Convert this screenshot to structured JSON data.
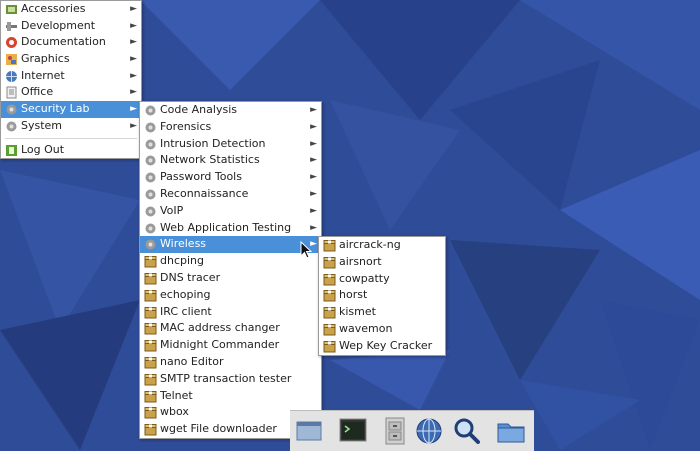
{
  "main_menu": {
    "items": [
      {
        "label": "Accessories",
        "icon": "accessories-icon",
        "submenu": true
      },
      {
        "label": "Development",
        "icon": "development-icon",
        "submenu": true
      },
      {
        "label": "Documentation",
        "icon": "documentation-icon",
        "submenu": true
      },
      {
        "label": "Graphics",
        "icon": "graphics-icon",
        "submenu": true
      },
      {
        "label": "Internet",
        "icon": "internet-icon",
        "submenu": true
      },
      {
        "label": "Office",
        "icon": "office-icon",
        "submenu": true
      },
      {
        "label": "Security Lab",
        "icon": "gear-icon",
        "submenu": true,
        "active": true
      },
      {
        "label": "System",
        "icon": "gear-icon",
        "submenu": true
      }
    ],
    "logout_label": "Log Out"
  },
  "security_menu": {
    "items": [
      {
        "label": "Code Analysis",
        "icon": "gear-icon",
        "submenu": true
      },
      {
        "label": "Forensics",
        "icon": "gear-icon",
        "submenu": true
      },
      {
        "label": "Intrusion Detection",
        "icon": "gear-icon",
        "submenu": true
      },
      {
        "label": "Network Statistics",
        "icon": "gear-icon",
        "submenu": true
      },
      {
        "label": "Password Tools",
        "icon": "gear-icon",
        "submenu": true
      },
      {
        "label": "Reconnaissance",
        "icon": "gear-icon",
        "submenu": true
      },
      {
        "label": "VoIP",
        "icon": "gear-icon",
        "submenu": true
      },
      {
        "label": "Web Application Testing",
        "icon": "gear-icon",
        "submenu": true
      },
      {
        "label": "Wireless",
        "icon": "gear-icon",
        "submenu": true,
        "active": true
      },
      {
        "label": "dhcping",
        "icon": "package-icon"
      },
      {
        "label": "DNS tracer",
        "icon": "package-icon"
      },
      {
        "label": "echoping",
        "icon": "package-icon"
      },
      {
        "label": "IRC client",
        "icon": "package-icon"
      },
      {
        "label": "MAC address changer",
        "icon": "package-icon"
      },
      {
        "label": "Midnight Commander",
        "icon": "package-icon"
      },
      {
        "label": "nano Editor",
        "icon": "package-icon"
      },
      {
        "label": "SMTP transaction tester",
        "icon": "package-icon"
      },
      {
        "label": "Telnet",
        "icon": "package-icon"
      },
      {
        "label": "wbox",
        "icon": "package-icon"
      },
      {
        "label": "wget File downloader",
        "icon": "package-icon"
      }
    ]
  },
  "wireless_menu": {
    "items": [
      {
        "label": "aircrack-ng",
        "icon": "package-icon"
      },
      {
        "label": "airsnort",
        "icon": "package-icon"
      },
      {
        "label": "cowpatty",
        "icon": "package-icon"
      },
      {
        "label": "horst",
        "icon": "package-icon"
      },
      {
        "label": "kismet",
        "icon": "package-icon"
      },
      {
        "label": "wavemon",
        "icon": "package-icon"
      },
      {
        "label": "Wep Key Cracker",
        "icon": "package-icon"
      }
    ]
  },
  "taskbar": {
    "launchers": [
      "window-icon",
      "terminal-icon",
      "file-cabinet-icon",
      "web-browser-icon",
      "search-icon",
      "folder-icon"
    ]
  },
  "colors": {
    "highlight": "#4a90d9",
    "desktop": "#2f4c98",
    "menu_bg": "#ffffff"
  }
}
